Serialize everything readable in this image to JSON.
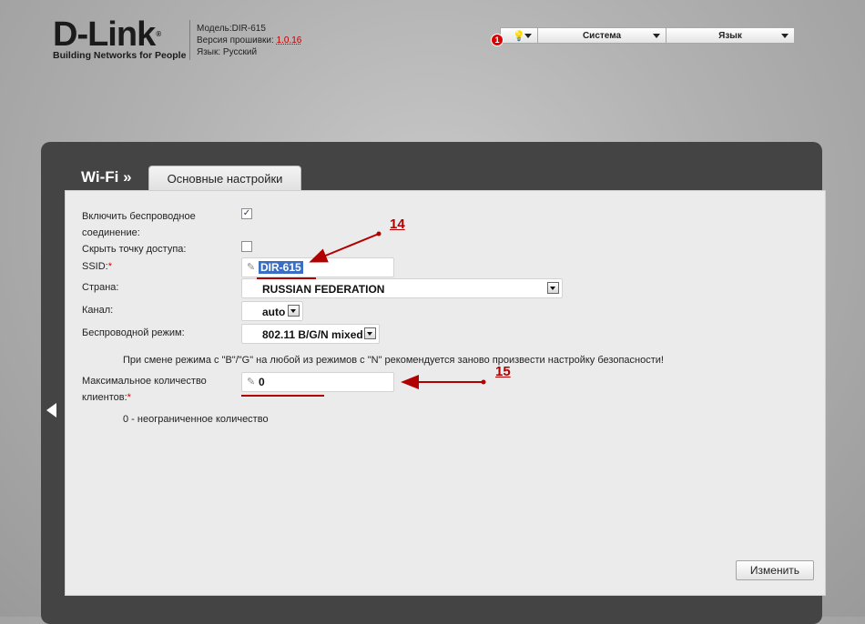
{
  "header": {
    "logo_main": "D-Link",
    "logo_reg": "®",
    "logo_sub": "Building Networks for People",
    "model": "Модель:DIR-615",
    "firmware_label": "Версия прошивки: ",
    "firmware_value": "1.0.16",
    "language_info": "Язык: Русский"
  },
  "toolbar": {
    "notification_count": "1",
    "system_label": "Система",
    "language_label": "Язык"
  },
  "page": {
    "section": "Wi-Fi »",
    "tab": "Основные настройки"
  },
  "form": {
    "enable_wireless_line1": "Включить беспроводное",
    "enable_wireless_line2": "соединение:",
    "enable_wireless_checked": "✓",
    "hide_ap_label": "Скрыть точку доступа:",
    "ssid_label": "SSID:",
    "ssid_value": "DIR-615",
    "country_label": "Страна:",
    "country_value": "RUSSIAN FEDERATION",
    "channel_label": "Канал:",
    "channel_value": "auto",
    "mode_label": "Беспроводной режим:",
    "mode_value": "802.11 B/G/N mixed",
    "mode_note": "При смене режима с \"B\"/\"G\" на любой из режимов с \"N\" рекомендуется заново произвести настройку безопасности!",
    "max_clients_line1": "Максимальное количество",
    "max_clients_line2": "клиентов:",
    "max_clients_value": "0",
    "max_clients_note": "0 - неограниченное количество",
    "required_mark": "*"
  },
  "annotations": {
    "a14": "14",
    "a15": "15",
    "color": "#b10000"
  },
  "actions": {
    "change_button": "Изменить"
  }
}
